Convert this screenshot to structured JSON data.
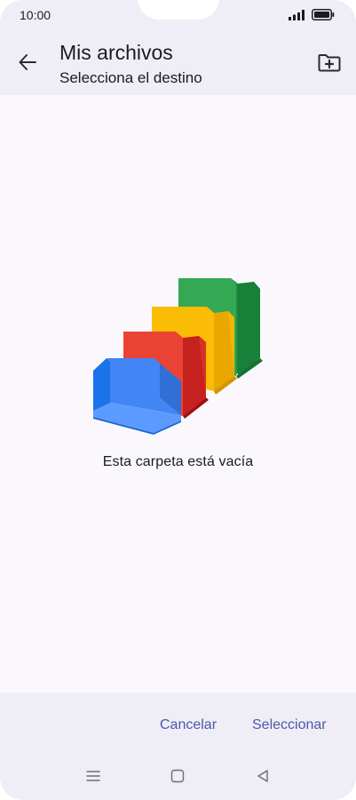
{
  "status_bar": {
    "time": "10:00",
    "signal_icon": "signal-icon",
    "battery_icon": "battery-icon"
  },
  "header": {
    "title": "Mis archivos",
    "subtitle": "Selecciona el destino",
    "back_icon": "arrow-back-icon",
    "new_folder_icon": "create-folder-icon"
  },
  "content": {
    "empty_illustration": "empty-folders-illustration",
    "empty_message": "Esta carpeta está vacía"
  },
  "actions": {
    "cancel_label": "Cancelar",
    "select_label": "Seleccionar"
  },
  "navigation_bar": {
    "menu_icon": "menu-icon",
    "home_icon": "home-square-icon",
    "back_icon": "back-triangle-icon"
  },
  "colors": {
    "header_bg": "#efedf6",
    "page_bg": "#fbf8fd",
    "accent": "#4a5aa8",
    "folder_blue": "#4285f4",
    "folder_red": "#ea4335",
    "folder_yellow": "#fbbc05",
    "folder_green": "#34a853"
  }
}
